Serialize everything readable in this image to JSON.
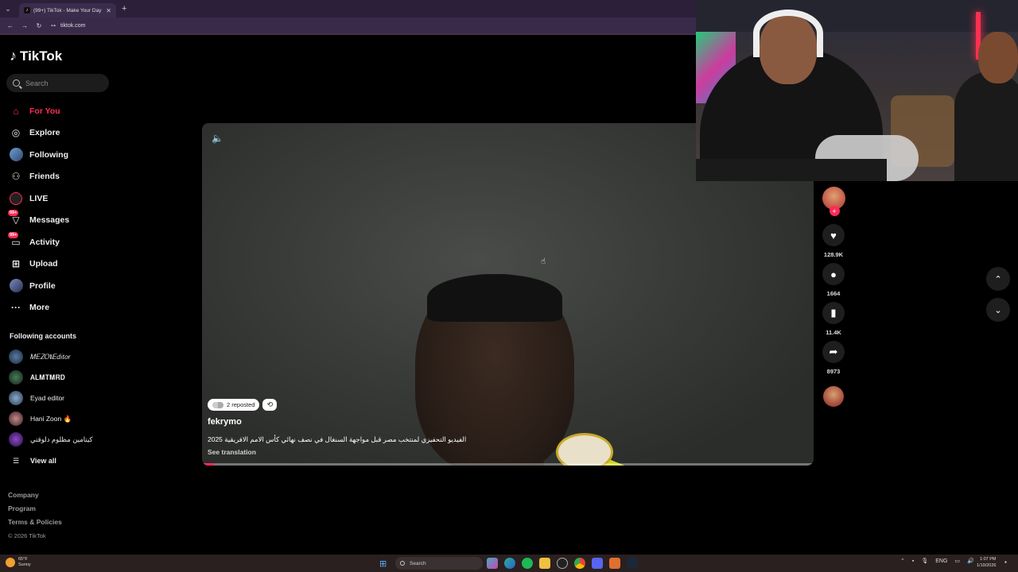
{
  "browser": {
    "tab_title": "(99+) TikTok - Make Your Day",
    "url": "tiktok.com",
    "new_tab_symbol": "+",
    "close_symbol": "✕"
  },
  "app": {
    "logo_text": "TikTok",
    "search_placeholder": "Search"
  },
  "menu": [
    {
      "label": "For You",
      "icon": "home-icon",
      "active": true
    },
    {
      "label": "Explore",
      "icon": "compass-icon"
    },
    {
      "label": "Following",
      "icon": "following-icon"
    },
    {
      "label": "Friends",
      "icon": "friends-icon"
    },
    {
      "label": "LIVE",
      "icon": "live-icon"
    },
    {
      "label": "Messages",
      "icon": "messages-icon",
      "badge": "99+"
    },
    {
      "label": "Activity",
      "icon": "activity-icon",
      "badge": "99+"
    },
    {
      "label": "Upload",
      "icon": "upload-icon"
    },
    {
      "label": "Profile",
      "icon": "profile-icon"
    },
    {
      "label": "More",
      "icon": "more-icon"
    }
  ],
  "following_accounts": {
    "title": "Following accounts",
    "accounts": [
      {
        "name": "𝑀𝐸𝑍𝑂‖𝐸𝑑𝑖𝑡𝑜𝑟",
        "color": "#3d5a80"
      },
      {
        "name": "𝐀𝐋𝐌𝐓𝐌𝐑𝐃",
        "color": "#2e4a3a"
      },
      {
        "name": "Eyad editor",
        "color": "#4a6a8a"
      },
      {
        "name": "Hani Zoon 🔥",
        "color": "#8a5a5a"
      },
      {
        "name": "كيتامين مظلوم دلوقتي",
        "color": "#5a2a8a"
      }
    ],
    "view_all": "View all"
  },
  "footer": {
    "links": [
      "Company",
      "Program",
      "Terms & Policies"
    ],
    "copyright": "© 2026 TikTok"
  },
  "video": {
    "reposted": "2 reposted",
    "author": "fekrymo",
    "caption": "الفيديو التحفيزي لمنتخب مصر قبل مواجهة السنغال في نصف نهائي كأس الامم الافريقية 2025",
    "see_translation": "See translation",
    "progress": 0.02
  },
  "actions": {
    "likes": "128.9K",
    "comments": "1664",
    "saves": "11.4K",
    "shares": "8973"
  },
  "taskbar": {
    "temp": "65°F",
    "weather": "Sunny",
    "search": "Search",
    "time": "1:07 PM",
    "date": "1/19/2026",
    "lang": "ENG"
  }
}
